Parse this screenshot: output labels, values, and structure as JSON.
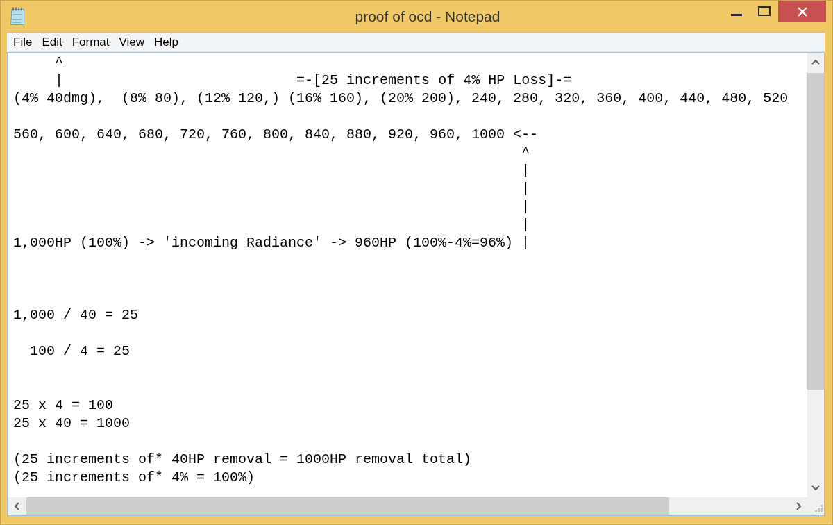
{
  "window": {
    "title": "proof of ocd - Notepad"
  },
  "menu": [
    "File",
    "Edit",
    "Format",
    "View",
    "Help"
  ],
  "document": {
    "lines": [
      {
        "kind": "text",
        "text": "     ^",
        "cursor": false
      },
      {
        "kind": "text",
        "text": "     |                            =-[25 increments of 4% HP Loss]-=",
        "cursor": false
      },
      {
        "kind": "text",
        "text": "(4% 40dmg),  (8% 80), (12% 120,) (16% 160), (20% 200), 240, 280, 320, 360, 400, 440, 480, 520",
        "cursor": false
      },
      {
        "kind": "blank",
        "cursor": false
      },
      {
        "kind": "text",
        "text": "560, 600, 640, 680, 720, 760, 800, 840, 880, 920, 960, 1000 <--",
        "cursor": false
      },
      {
        "kind": "text",
        "text": "                                                             ^",
        "cursor": false
      },
      {
        "kind": "text",
        "text": "                                                             |",
        "cursor": false
      },
      {
        "kind": "text",
        "text": "                                                             |",
        "cursor": false
      },
      {
        "kind": "text",
        "text": "                                                             |",
        "cursor": false
      },
      {
        "kind": "text",
        "text": "                                                             |",
        "cursor": false
      },
      {
        "kind": "text",
        "text": "1,000HP (100%) -> 'incoming Radiance' -> 960HP (100%-4%=96%) |",
        "cursor": false
      },
      {
        "kind": "blank",
        "cursor": false
      },
      {
        "kind": "blank",
        "cursor": false
      },
      {
        "kind": "blank",
        "cursor": false
      },
      {
        "kind": "text",
        "text": "1,000 / 40 = 25",
        "cursor": false
      },
      {
        "kind": "blank",
        "cursor": false
      },
      {
        "kind": "text",
        "text": "  100 / 4 = 25",
        "cursor": false
      },
      {
        "kind": "blank",
        "cursor": false
      },
      {
        "kind": "blank",
        "cursor": false
      },
      {
        "kind": "text",
        "text": "25 x 4 = 100",
        "cursor": false
      },
      {
        "kind": "text",
        "text": "25 x 40 = 1000",
        "cursor": false
      },
      {
        "kind": "blank",
        "cursor": false
      },
      {
        "kind": "text",
        "text": "(25 increments of* 40HP removal = 1000HP removal total)",
        "cursor": false
      },
      {
        "kind": "text",
        "text": "(25 increments of* 4% = 100%)",
        "cursor": true
      }
    ]
  }
}
